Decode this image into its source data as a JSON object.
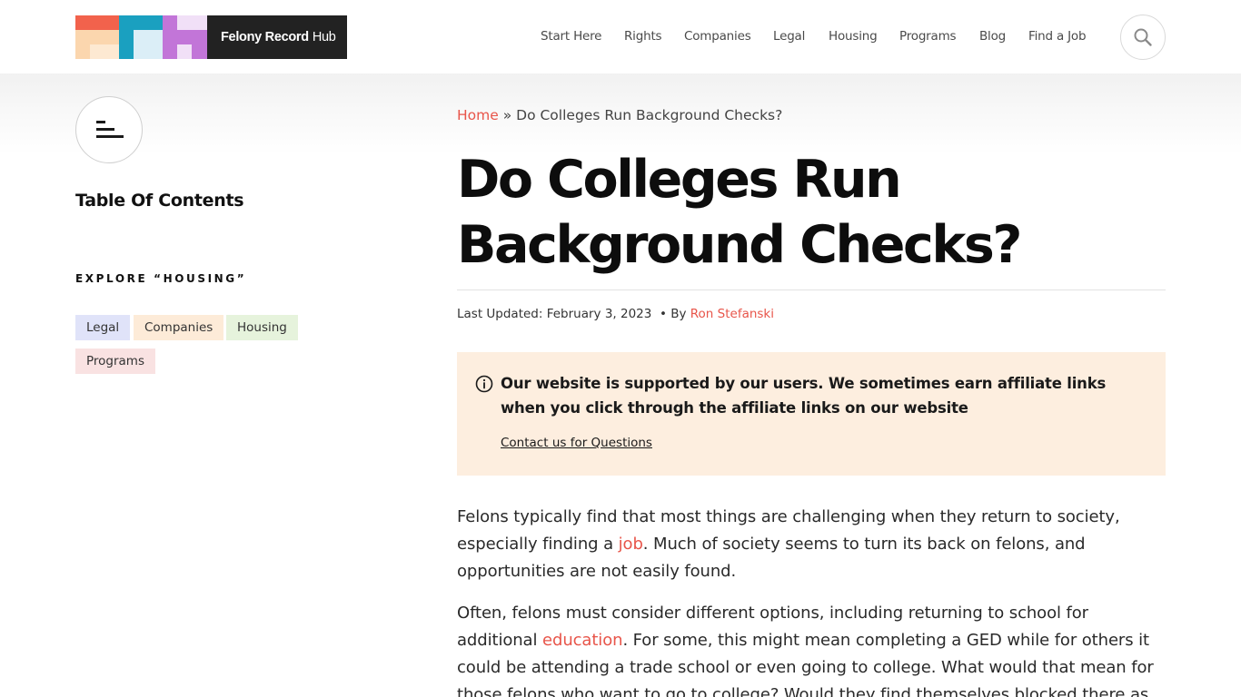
{
  "site": {
    "logo_name_bold": "Felony Record",
    "logo_name_rest": "Hub",
    "colors": {
      "accent": "#e8554a",
      "logo_dark": "#222222",
      "logo_red": "#f2624c",
      "logo_peach": "#fbd6ae",
      "logo_cream": "#fde9d2",
      "logo_teal": "#1aa0c0",
      "logo_lightblue": "#dbeef7",
      "logo_purple": "#c275d8",
      "logo_lavender": "#f1e0f7"
    }
  },
  "nav": {
    "items": [
      {
        "label": "Start Here"
      },
      {
        "label": "Rights"
      },
      {
        "label": "Companies"
      },
      {
        "label": "Legal"
      },
      {
        "label": "Housing"
      },
      {
        "label": "Programs"
      },
      {
        "label": "Blog"
      },
      {
        "label": "Find a Job"
      }
    ],
    "search_icon": "search-icon"
  },
  "sidebar": {
    "toc_icon": "table-of-contents-icon",
    "toc_title": "Table Of Contents",
    "explore_title": "EXPLORE “HOUSING”",
    "tags": [
      {
        "label": "Legal",
        "color": "#e0e3f9"
      },
      {
        "label": "Companies",
        "color": "#fdebd8"
      },
      {
        "label": "Housing",
        "color": "#e6f3dc"
      },
      {
        "label": "Programs",
        "color": "#f9e2e2"
      }
    ]
  },
  "article": {
    "breadcrumb_home": "Home",
    "breadcrumb_sep": "»",
    "breadcrumb_current": "Do Colleges Run Background Checks?",
    "title": "Do Colleges Run Background Checks?",
    "meta_updated": "Last Updated: February 3, 2023",
    "meta_by": "• By",
    "meta_author": "Ron Stefanski",
    "notice_icon": "info-circle-icon",
    "notice_text": "Our website is supported by our users. We sometimes earn affiliate links when you click through the affiliate links on our website",
    "notice_link": "Contact us for Questions",
    "p1_a": "Felons typically find that most things are challenging when they return to society, especially finding a ",
    "p1_link": "job",
    "p1_b": ". Much of society seems to turn its back on felons, and opportunities are not easily found.",
    "p2_a": "Often, felons must consider different options, including returning to school for additional ",
    "p2_link": "education",
    "p2_b": ". For some, this might mean completing a GED while for others it could be attending a trade school or even going to college. What would that mean for those felons who want to go to college? Would they find themselves blocked there as"
  }
}
